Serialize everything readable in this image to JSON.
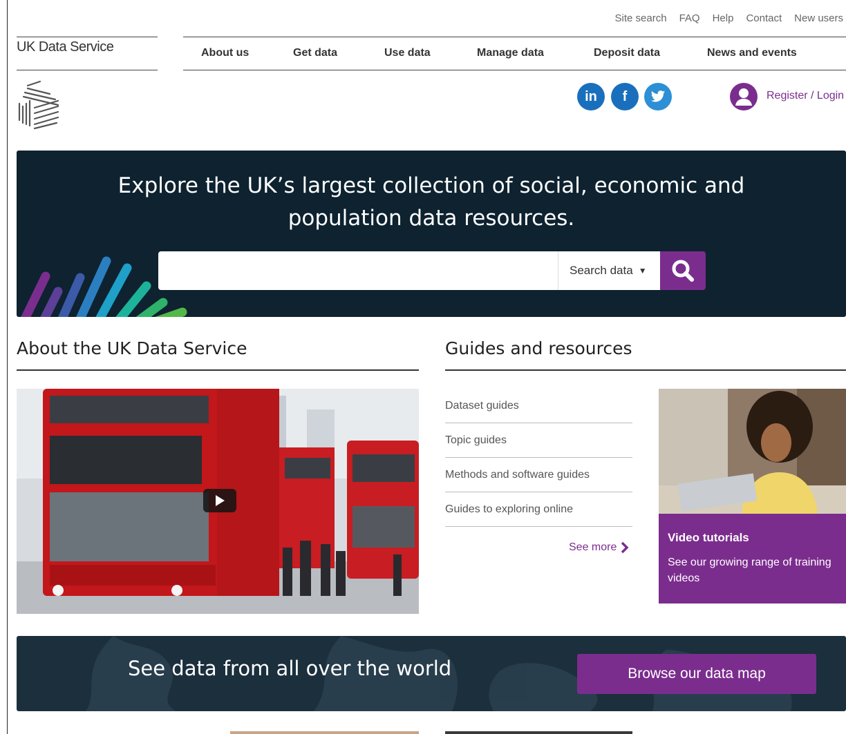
{
  "utility_nav": [
    "Site search",
    "FAQ",
    "Help",
    "Contact",
    "New users"
  ],
  "brand": {
    "name": "UK Data Service"
  },
  "main_nav": [
    "About us",
    "Get data",
    "Use data",
    "Manage data",
    "Deposit data",
    "News and events"
  ],
  "social": {
    "linkedin": "in",
    "facebook": "f"
  },
  "account": {
    "login_label": "Register / Login"
  },
  "hero": {
    "title_line1": "Explore the UK’s largest collection of social, economic and",
    "title_line2": "population data resources.",
    "search_placeholder": "",
    "search_scope": "Search data"
  },
  "about": {
    "heading": "About the UK Data Service"
  },
  "guides": {
    "heading": "Guides and resources",
    "items": [
      "Dataset guides",
      "Topic guides",
      "Methods and software guides",
      "Guides to exploring online"
    ],
    "see_more": "See more"
  },
  "video_card": {
    "title": "Video tutorials",
    "description": "See our growing range of training videos"
  },
  "map_banner": {
    "text": "See data from all over the world",
    "button": "Browse our data map"
  },
  "colors": {
    "purple": "#7b2d8e",
    "hero_bg": "#0e2230",
    "map_bg": "#1c2f3d",
    "social_blue": "#1a6fbd"
  }
}
